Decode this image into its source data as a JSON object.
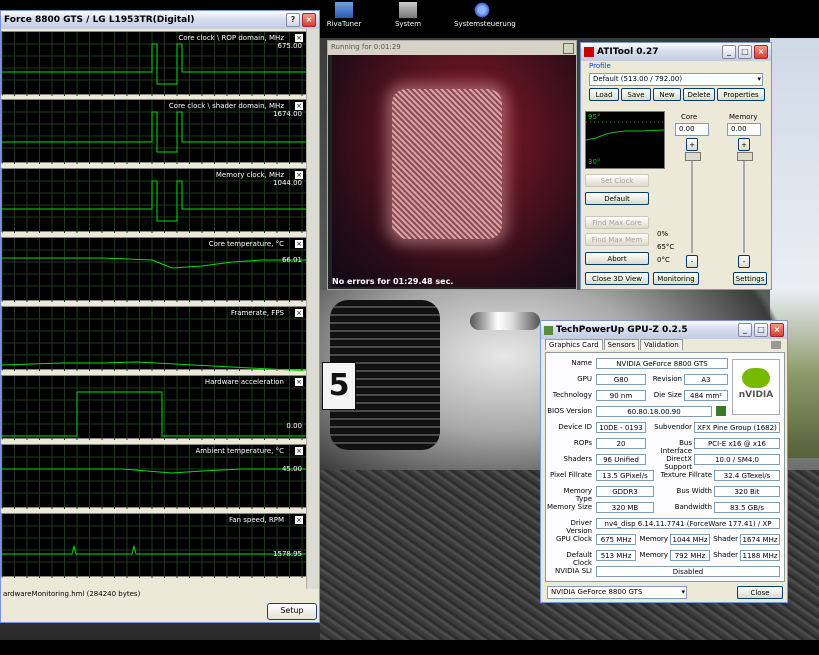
{
  "desktop": {
    "icons": [
      "RivaTuner",
      "System",
      "Systemsteuerung"
    ]
  },
  "monitor": {
    "title": "Force 8800 GTS / LG L1953TR(Digital)",
    "panels": [
      {
        "label": "Core clock \\ ROP domain, MHz",
        "value": "675.00"
      },
      {
        "label": "Core clock \\ shader domain, MHz",
        "value": "1674.00"
      },
      {
        "label": "Memory clock, MHz",
        "value": "1044.00"
      },
      {
        "label": "Core temperature, °C",
        "value": "66.01"
      },
      {
        "label": "Framerate, FPS",
        "value": ""
      },
      {
        "label": "Hardware acceleration",
        "value": "0.00"
      },
      {
        "label": "Ambient temperature, °C",
        "value": "45.00"
      },
      {
        "label": "Fan speed, RPM",
        "value": "1578.95"
      }
    ],
    "status": "ardwareMonitoring.hml (284240 bytes)",
    "setup_button": "Setup"
  },
  "render": {
    "title": "Running for 0:01:29",
    "message": "No errors for 01:29.48 sec."
  },
  "ati": {
    "title": "ATITool 0.27",
    "profile_label": "Profile",
    "profile_value": "Default (513.00 / 792.00)",
    "buttons": [
      "Load",
      "Save",
      "New",
      "Delete",
      "Properties"
    ],
    "graph_top": "95°",
    "graph_bottom": "30°",
    "core_label": "Core",
    "memory_label": "Memory",
    "core_value": "0.00",
    "memory_value": "0.00",
    "set_clock": "Set Clock",
    "default_btn": "Default",
    "find_max_core": "Find Max Core",
    "find_max_mem": "Find Max Mem",
    "abort": "Abort",
    "close_3d": "Close 3D View",
    "monitoring": "Monitoring",
    "settings": "Settings",
    "pct": "0%",
    "temp_c": "65°C",
    "zero_c": "0°C",
    "plus": "+",
    "minus": "-"
  },
  "gpuz": {
    "title": "TechPowerUp GPU-Z 0.2.5",
    "tabs": [
      "Graphics Card",
      "Sensors",
      "Validation"
    ],
    "name_label": "Name",
    "name": "NVIDIA GeForce 8800 GTS",
    "gpu_label": "GPU",
    "gpu": "G80",
    "revision_label": "Revision",
    "revision": "A3",
    "tech_label": "Technology",
    "tech": "90 nm",
    "die_label": "Die Size",
    "die": "484 mm²",
    "bios_label": "BIOS Version",
    "bios": "60.80.18.00.90",
    "devid_label": "Device ID",
    "devid": "10DE - 0193",
    "subvendor_label": "Subvendor",
    "subvendor": "XFX Pine Group (1682)",
    "rops_label": "ROPs",
    "rops": "20",
    "bus_label": "Bus Interface",
    "bus": "PCI-E x16 @ x16",
    "shaders_label": "Shaders",
    "shaders": "96 Unified",
    "dx_label": "DirectX Support",
    "dx": "10.0 / SM4.0",
    "pixel_label": "Pixel Fillrate",
    "pixel": "13.5 GPixel/s",
    "texture_label": "Texture Fillrate",
    "texture": "32.4 GTexel/s",
    "memtype_label": "Memory Type",
    "memtype": "GDDR3",
    "buswidth_label": "Bus Width",
    "buswidth": "320 Bit",
    "memsize_label": "Memory Size",
    "memsize": "320 MB",
    "bandwidth_label": "Bandwidth",
    "bandwidth": "83.5 GB/s",
    "driver_label": "Driver Version",
    "driver": "nv4_disp 6.14.11.7741 (ForceWare 177.41) / XP",
    "gpuclock_label": "GPU Clock",
    "gpuclock": "675 MHz",
    "memory_label": "Memory",
    "gpumem": "1044 MHz",
    "shader_label": "Shader",
    "gpushader": "1674 MHz",
    "defclock_label": "Default Clock",
    "defclock": "513 MHz",
    "defmem": "792 MHz",
    "defshader": "1188 MHz",
    "sli_label": "NVIDIA SLI",
    "sli": "Disabled",
    "select": "NVIDIA GeForce 8800 GTS",
    "close": "Close",
    "logo": "nVIDIA"
  }
}
